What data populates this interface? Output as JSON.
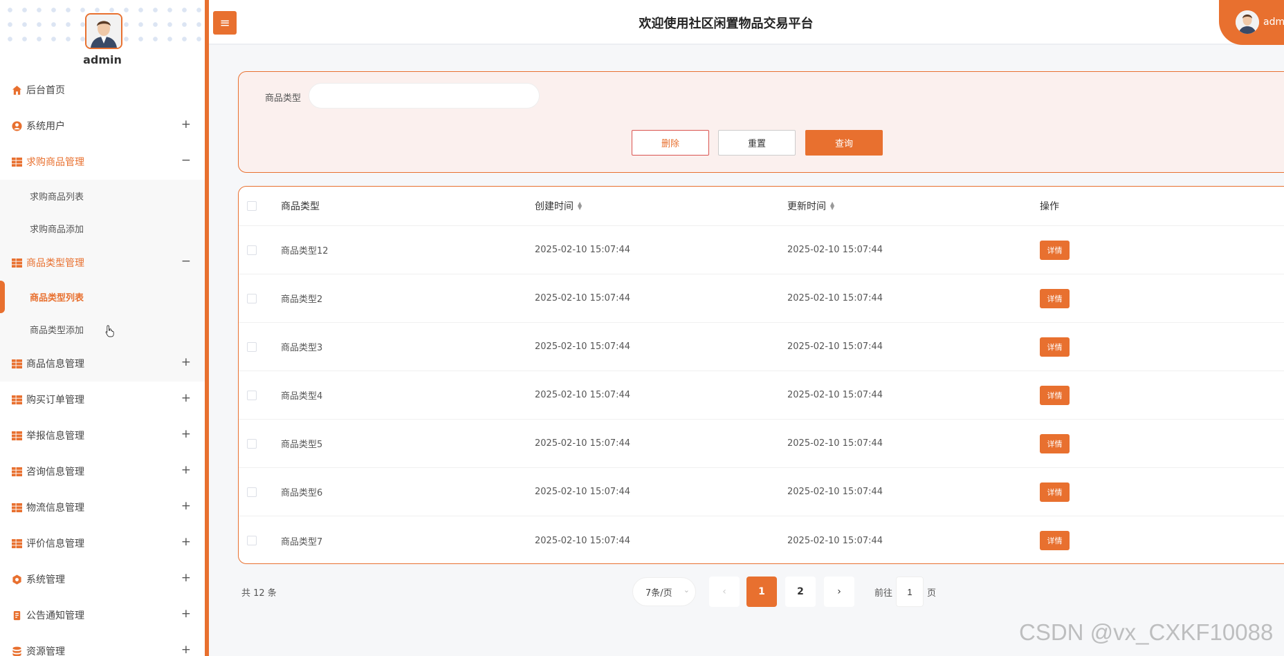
{
  "sidebar": {
    "admin_name": "admin",
    "items": [
      {
        "label": "后台首页",
        "icon": "home-icon",
        "toggle": ""
      },
      {
        "label": "系统用户",
        "icon": "user-icon",
        "toggle": "+"
      },
      {
        "label": "求购商品管理",
        "icon": "grid-icon",
        "toggle": "−"
      },
      {
        "label": "商品类型管理",
        "icon": "grid-icon",
        "toggle": "−"
      },
      {
        "label": "商品信息管理",
        "icon": "grid-icon",
        "toggle": "+"
      },
      {
        "label": "购买订单管理",
        "icon": "grid-icon",
        "toggle": "+"
      },
      {
        "label": "举报信息管理",
        "icon": "grid-icon",
        "toggle": "+"
      },
      {
        "label": "咨询信息管理",
        "icon": "grid-icon",
        "toggle": "+"
      },
      {
        "label": "物流信息管理",
        "icon": "grid-icon",
        "toggle": "+"
      },
      {
        "label": "评价信息管理",
        "icon": "grid-icon",
        "toggle": "+"
      },
      {
        "label": "系统管理",
        "icon": "gear-icon",
        "toggle": "+"
      },
      {
        "label": "公告通知管理",
        "icon": "notice-icon",
        "toggle": "+"
      },
      {
        "label": "资源管理",
        "icon": "database-icon",
        "toggle": "+"
      }
    ],
    "qiugou_sub": [
      "求购商品列表",
      "求购商品添加"
    ],
    "type_sub": [
      "商品类型列表",
      "商品类型添加"
    ]
  },
  "header": {
    "title": "欢迎使用社区闲置物品交易平台",
    "user": "adm"
  },
  "search": {
    "label": "商品类型",
    "value": "",
    "delete_label": "删除",
    "reset_label": "重置",
    "query_label": "查询"
  },
  "table": {
    "headers": {
      "type": "商品类型",
      "created": "创建时间",
      "updated": "更新时间",
      "op": "操作"
    },
    "rows": [
      {
        "type": "商品类型12",
        "created": "2025-02-10 15:07:44",
        "updated": "2025-02-10 15:07:44",
        "action": "详情"
      },
      {
        "type": "商品类型2",
        "created": "2025-02-10 15:07:44",
        "updated": "2025-02-10 15:07:44",
        "action": "详情"
      },
      {
        "type": "商品类型3",
        "created": "2025-02-10 15:07:44",
        "updated": "2025-02-10 15:07:44",
        "action": "详情"
      },
      {
        "type": "商品类型4",
        "created": "2025-02-10 15:07:44",
        "updated": "2025-02-10 15:07:44",
        "action": "详情"
      },
      {
        "type": "商品类型5",
        "created": "2025-02-10 15:07:44",
        "updated": "2025-02-10 15:07:44",
        "action": "详情"
      },
      {
        "type": "商品类型6",
        "created": "2025-02-10 15:07:44",
        "updated": "2025-02-10 15:07:44",
        "action": "详情"
      },
      {
        "type": "商品类型7",
        "created": "2025-02-10 15:07:44",
        "updated": "2025-02-10 15:07:44",
        "action": "详情"
      }
    ]
  },
  "pagination": {
    "total": "共 12 条",
    "page_size": "7条/页",
    "pages": [
      "1",
      "2"
    ],
    "current_page": "1",
    "goto_label": "前往",
    "goto_value": "1",
    "goto_unit": "页"
  },
  "watermark": "CSDN @vx_CXKF10088",
  "colors": {
    "accent": "#e8702f",
    "panel_bg": "#fbf0ee",
    "page_bg": "#f6f7f9"
  }
}
